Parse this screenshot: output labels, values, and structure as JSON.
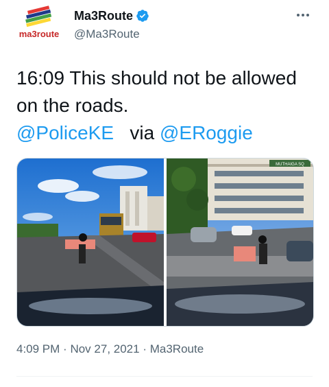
{
  "author": {
    "display_name": "Ma3Route",
    "handle": "@Ma3Route",
    "avatar_text": "ma3route",
    "avatar_icon": "ma3route-logo",
    "verified_icon": "verified-badge-icon",
    "verified_color": "#1d9bf0"
  },
  "tweet": {
    "text_prefix": "16:09 This should not be allowed on the roads.",
    "mention_1": "@PoliceKE",
    "via": "via",
    "mention_2": "@ERoggie",
    "mention_color": "#1d9bf0",
    "sign_text": "MUTHAIGA SQ"
  },
  "meta": {
    "time": "4:09 PM",
    "separator_1": "·",
    "date": "Nov 27, 2021",
    "separator_2": "·",
    "source": "Ma3Route"
  },
  "more_icon": "more-options-icon"
}
